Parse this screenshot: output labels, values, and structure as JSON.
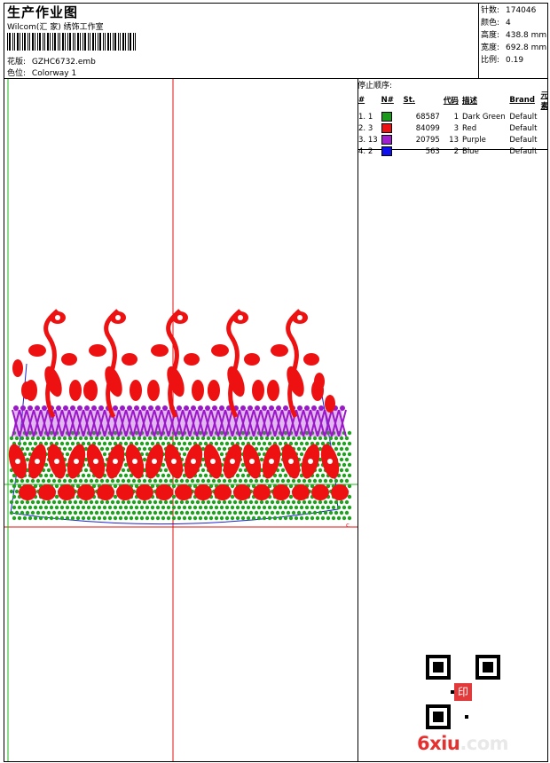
{
  "header": {
    "title": "生产作业图",
    "company": "Wilcom(汇 家) 绣饰工作室",
    "design_label": "花版:",
    "design_value": "GZHC6732.emb",
    "colorway_label": "色位:",
    "colorway_value": "Colorway 1"
  },
  "stats": [
    {
      "label": "针数:",
      "value": "174046"
    },
    {
      "label": "颜色:",
      "value": "4"
    },
    {
      "label": "高度:",
      "value": "438.8 mm"
    },
    {
      "label": "宽度:",
      "value": "692.8 mm"
    },
    {
      "label": "比例:",
      "value": "0.19"
    }
  ],
  "stop_sequence": {
    "title": "停止顺序:",
    "headers": [
      "#",
      "N#",
      "St.",
      "代码",
      "描述",
      "Brand",
      "元素"
    ],
    "rows": [
      {
        "idx": "1.",
        "n": "1",
        "color": "#1a9a1a",
        "st": "68587",
        "code": "1",
        "desc": "Dark Green",
        "brand": "Default"
      },
      {
        "idx": "2.",
        "n": "3",
        "color": "#ee1111",
        "st": "84099",
        "code": "3",
        "desc": "Red",
        "brand": "Default"
      },
      {
        "idx": "3.",
        "n": "13",
        "color": "#a020d0",
        "st": "20795",
        "code": "13",
        "desc": "Purple",
        "brand": "Default"
      },
      {
        "idx": "4.",
        "n": "2",
        "color": "#1010ee",
        "st": "563",
        "code": "2",
        "desc": "Blue",
        "brand": "Default"
      }
    ]
  },
  "watermark": {
    "main": "6xiu",
    "suffix": ".com"
  },
  "qr_stamp": "印"
}
